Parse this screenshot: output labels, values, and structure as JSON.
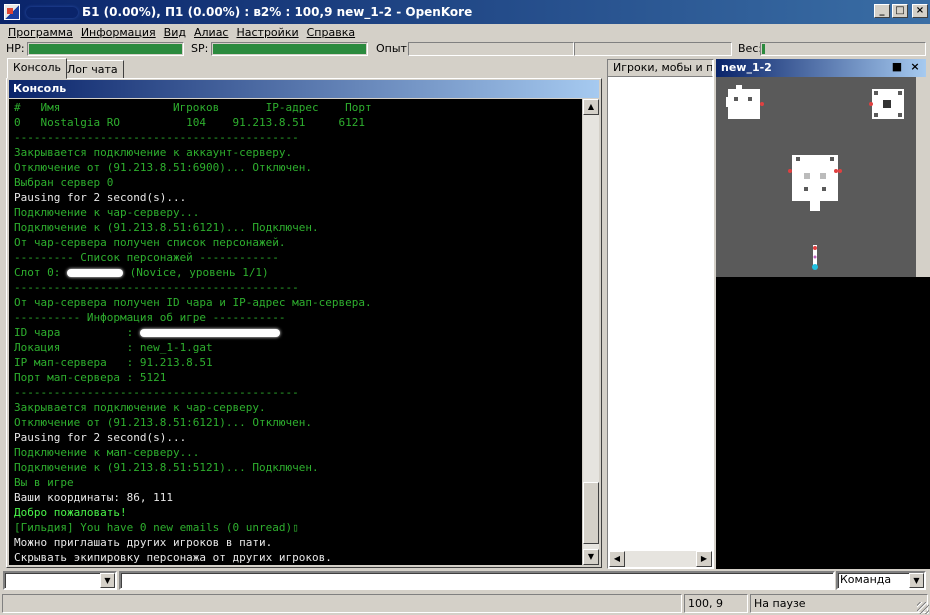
{
  "window": {
    "title": "Б1 (0.00%), П1 (0.00%) : в2% : 100,9 new_1-2 - OpenKore",
    "controls": [
      "_",
      "□",
      "×"
    ]
  },
  "menu": [
    "Программа",
    "Информация",
    "Вид",
    "Алиас",
    "Настройки",
    "Справка"
  ],
  "stats": {
    "hp_label": "HP:",
    "hp_fill": 1.0,
    "sp_label": "SP:",
    "sp_fill": 1.0,
    "exp_label": "Опыт:",
    "weight_label": "Вес:",
    "bar_color": "#2b8a3e"
  },
  "tabs": [
    "Консоль",
    "Лог чата"
  ],
  "console": {
    "header": "Консоль",
    "lines": [
      {
        "text": "#   Имя                 Игроков       IP-адрес    Порт",
        "color": "green"
      },
      {
        "text": "0   Nostalgia RO          104    91.213.8.51     6121",
        "color": "green"
      },
      {
        "text": "-------------------------------------------",
        "color": "green"
      },
      {
        "text": "Закрывается подключение к аккаунт-серверу.",
        "color": "green"
      },
      {
        "text": "Отключение от (91.213.8.51:6900)... Отключен.",
        "color": "green"
      },
      {
        "text": "Выбран сервер 0",
        "color": "green"
      },
      {
        "text": "Pausing for 2 second(s)...",
        "color": "white"
      },
      {
        "text": "Подключение к чар-серверу...",
        "color": "green"
      },
      {
        "text": "Подключение к (91.213.8.51:6121)... Подключен.",
        "color": "green"
      },
      {
        "text": "От чар-сервера получен список персонажей.",
        "color": "green"
      },
      {
        "text": "--------- Список персонажей ------------",
        "color": "green"
      },
      {
        "text": "Слот 0: ",
        "color": "green",
        "redact": 56,
        "suffix": " (Novice, уровень 1/1)"
      },
      {
        "text": "-------------------------------------------",
        "color": "green"
      },
      {
        "text": "От чар-сервера получен ID чара и IP-адрес мап-сервера.",
        "color": "green"
      },
      {
        "text": "---------- Информация об игре -----------",
        "color": "green"
      },
      {
        "text": "ID чара          : ",
        "color": "green",
        "redact": 140,
        "suffix": ""
      },
      {
        "text": "Локация          : new_1-1.gat",
        "color": "green"
      },
      {
        "text": "IP мап-сервера   : 91.213.8.51",
        "color": "green"
      },
      {
        "text": "Порт мап-сервера : 5121",
        "color": "green"
      },
      {
        "text": "-------------------------------------------",
        "color": "green"
      },
      {
        "text": "Закрывается подключение к чар-серверу.",
        "color": "green"
      },
      {
        "text": "Отключение от (91.213.8.51:6121)... Отключен.",
        "color": "green"
      },
      {
        "text": "Pausing for 2 second(s)...",
        "color": "white"
      },
      {
        "text": "Подключение к мап-серверу...",
        "color": "green"
      },
      {
        "text": "Подключение к (91.213.8.51:5121)... Подключен.",
        "color": "green"
      },
      {
        "text": "Вы в игре",
        "color": "green"
      },
      {
        "text": "Ваши координаты: 86, 111",
        "color": "white"
      },
      {
        "text": "Добро пожаловать!",
        "color": "bright"
      },
      {
        "text": "[Гильдия] You have 0 new emails (0 unread)▯",
        "color": "green"
      },
      {
        "text": "Можно приглашать других игроков в пати.",
        "color": "white"
      },
      {
        "text": "Скрывать экипировку персонажа от других игроков.",
        "color": "white"
      }
    ]
  },
  "players_panel": {
    "header": "Игроки, мобы и предметы"
  },
  "map_panel": {
    "title": "new_1-2",
    "restore": "■",
    "close": "×"
  },
  "input": {
    "command_value": "",
    "mode_selected": "Команда"
  },
  "status": {
    "coords": "100, 9",
    "state": "На паузе"
  }
}
